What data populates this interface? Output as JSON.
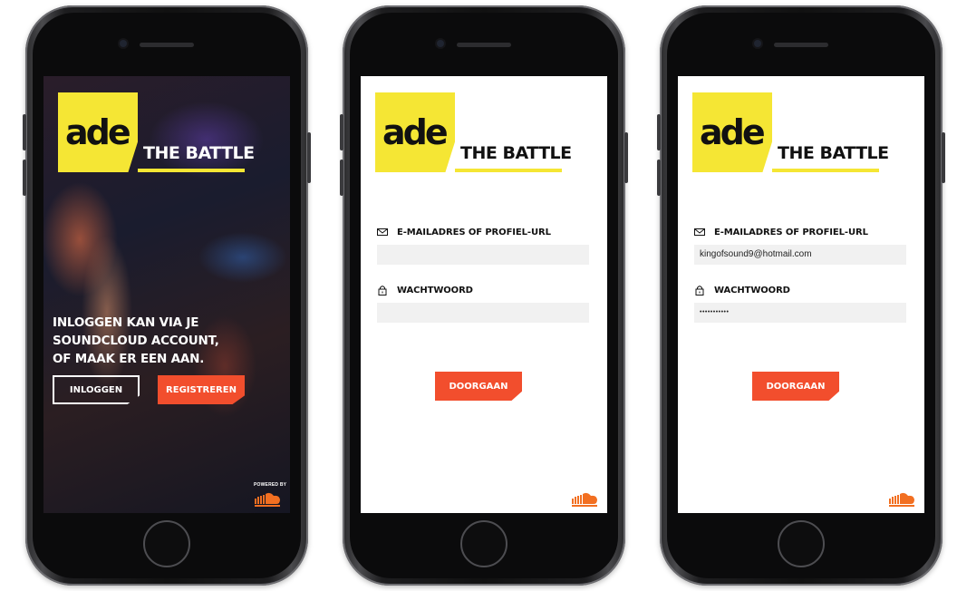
{
  "brand": {
    "logo_text": "ade",
    "title": "THE BATTLE",
    "accent_color": "#f5e634",
    "cta_color": "#f24e2d"
  },
  "screen1": {
    "tagline_lines": [
      "INLOGGEN KAN VIA JE",
      "SOUNDCLOUD ACCOUNT,",
      "OF MAAK ER EEN AAN."
    ],
    "login_label": "INLOGGEN",
    "register_label": "REGISTREREN",
    "powered_by": "POWERED BY",
    "soundcloud_icon": "soundcloud-logo"
  },
  "screen2": {
    "email_label": "E-MAILADRES OF PROFIEL-URL",
    "email_value": "",
    "password_label": "WACHTWOORD",
    "password_value": "",
    "continue_label": "DOORGAAN",
    "soundcloud_icon": "soundcloud-logo"
  },
  "screen3": {
    "email_label": "E-MAILADRES OF PROFIEL-URL",
    "email_value": "kingofsound9@hotmail.com",
    "password_label": "WACHTWOORD",
    "password_value": "•••••••••••",
    "continue_label": "DOORGAAN",
    "soundcloud_icon": "soundcloud-logo"
  }
}
